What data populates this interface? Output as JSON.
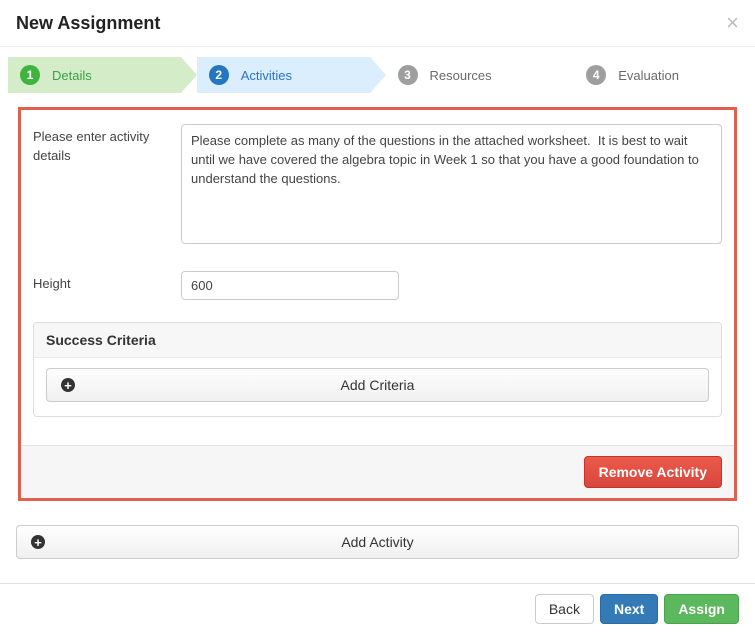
{
  "header": {
    "title": "New Assignment"
  },
  "steps": {
    "s1": {
      "num": "1",
      "label": "Details"
    },
    "s2": {
      "num": "2",
      "label": "Activities"
    },
    "s3": {
      "num": "3",
      "label": "Resources"
    },
    "s4": {
      "num": "4",
      "label": "Evaluation"
    }
  },
  "form": {
    "details_label": "Please enter activity details",
    "details_value": "Please complete as many of the questions in the attached worksheet.  It is best to wait until we have covered the algebra topic in Week 1 so that you have a good foundation to understand the questions.",
    "height_label": "Height",
    "height_value": "600"
  },
  "success": {
    "heading": "Success Criteria",
    "add_label": "Add Criteria"
  },
  "buttons": {
    "remove": "Remove Activity",
    "add_activity": "Add Activity",
    "back": "Back",
    "next": "Next",
    "assign": "Assign"
  }
}
